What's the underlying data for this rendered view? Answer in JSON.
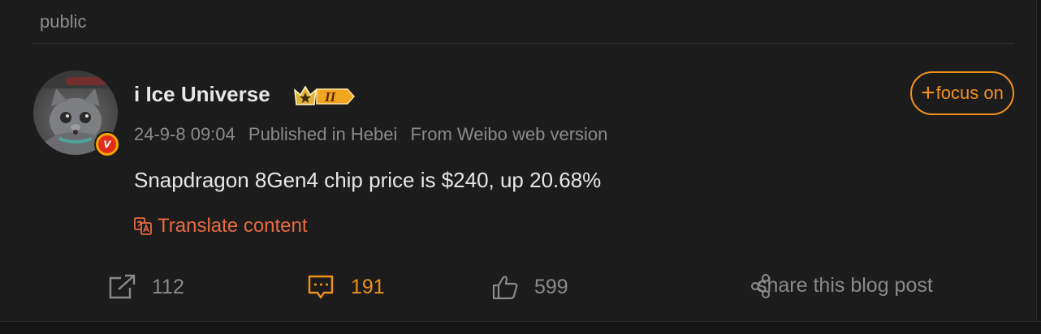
{
  "visibility_label": "public",
  "post": {
    "author": "i Ice Universe",
    "member_level": "II",
    "meta": {
      "time": "24-9-8 09:04",
      "location": "Published in Hebei",
      "source": "From Weibo web version"
    },
    "follow_label": "focus on",
    "text": "Snapdragon 8Gen4 chip price is $240, up 20.68%",
    "translate_label": "Translate content"
  },
  "actions": {
    "repost_count": "112",
    "comment_count": "191",
    "like_count": "599",
    "share_label": "share this blog post"
  },
  "icons": {
    "repost": "repost-icon",
    "comment": "comment-icon",
    "like": "thumbs-up-icon",
    "share": "share-icon",
    "translate": "translate-icon",
    "vip": "crown-badge-icon",
    "verified": "verified-v-icon"
  },
  "colors": {
    "accent": "#f0911e",
    "translate": "#e86a40",
    "verified_bg": "#f5a300",
    "verified_inner": "#e02d1b"
  }
}
